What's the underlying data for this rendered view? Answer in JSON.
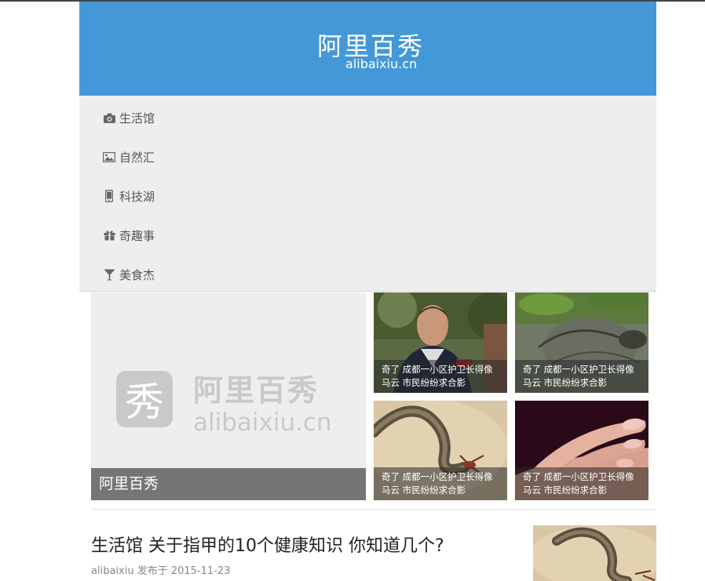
{
  "header": {
    "title": "阿里百秀",
    "subtitle": "alibaixiu.cn",
    "background_color": "#4498d8"
  },
  "nav": {
    "items": [
      {
        "label": "生活馆",
        "icon": "camera-icon"
      },
      {
        "label": "自然汇",
        "icon": "picture-icon"
      },
      {
        "label": "科技湖",
        "icon": "mobile-phone-icon"
      },
      {
        "label": "奇趣事",
        "icon": "gift-icon"
      },
      {
        "label": "美食杰",
        "icon": "cocktail-glass-icon"
      }
    ]
  },
  "slider": {
    "logo_title": "阿里百秀",
    "logo_sub": "alibaixiu.cn",
    "logo_mark": "秀",
    "caption": "阿里百秀"
  },
  "thumbs": [
    {
      "line1": "奇了 成都一小区护卫长得像",
      "line2": "马云 市民纷纷求合影",
      "image": "man-portrait"
    },
    {
      "line1": "奇了 成都一小区护卫长得像",
      "line2": "马云 市民纷纷求合影",
      "image": "mossy-ground"
    },
    {
      "line1": "奇了 成都一小区护卫长得像",
      "line2": "马云 市民纷纷求合影",
      "image": "snake"
    },
    {
      "line1": "奇了 成都一小区护卫长得像",
      "line2": "马云 市民纷纷求合影",
      "image": "fingers"
    }
  ],
  "article": {
    "title": "生活馆 关于指甲的10个健康知识 你知道几个?",
    "meta": "alibaixiu 发布于 2015-11-23",
    "image": "snake"
  }
}
